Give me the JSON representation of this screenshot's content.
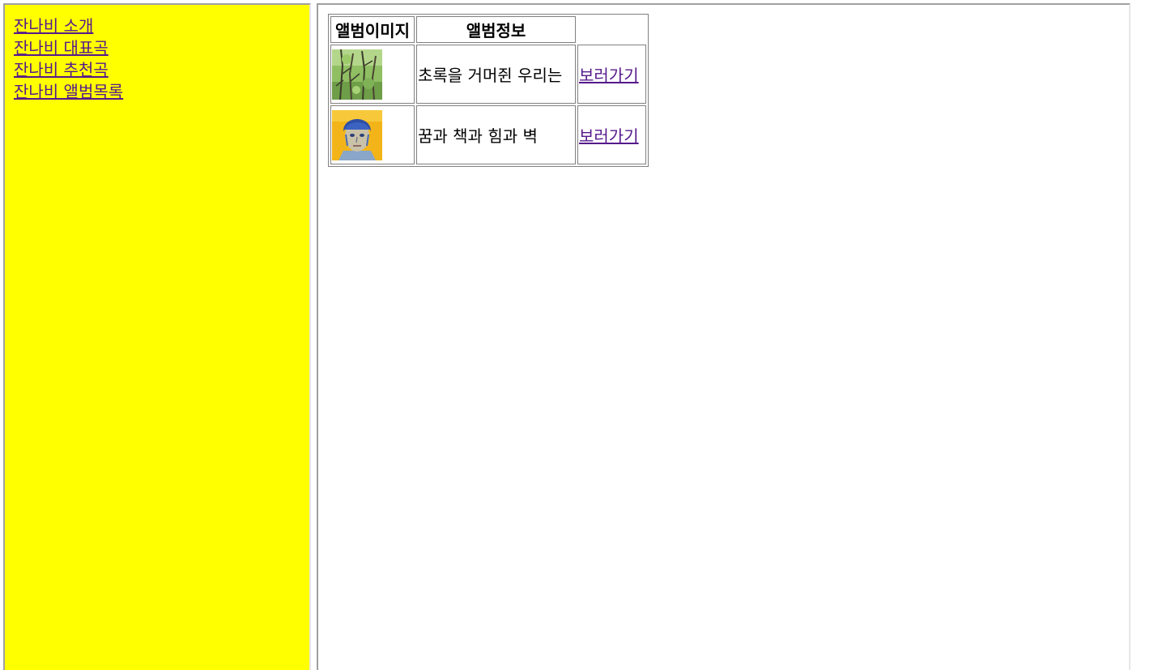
{
  "nav": {
    "items": [
      {
        "label": "잔나비 소개"
      },
      {
        "label": "잔나비 대표곡"
      },
      {
        "label": "잔나비 추천곡"
      },
      {
        "label": "잔나비 앨범목록"
      }
    ]
  },
  "table": {
    "headers": [
      "앨범이미지",
      "앨범정보"
    ],
    "rows": [
      {
        "info": "초록을 거머쥔 우리는",
        "link": "보러가기",
        "image": "album-cover-green-trees"
      },
      {
        "info": "꿈과 책과 힘과 벽",
        "link": "보러가기",
        "image": "album-cover-blue-face"
      }
    ]
  },
  "colors": {
    "sidebar_bg": "#ffff00",
    "link": "#551a8b"
  }
}
